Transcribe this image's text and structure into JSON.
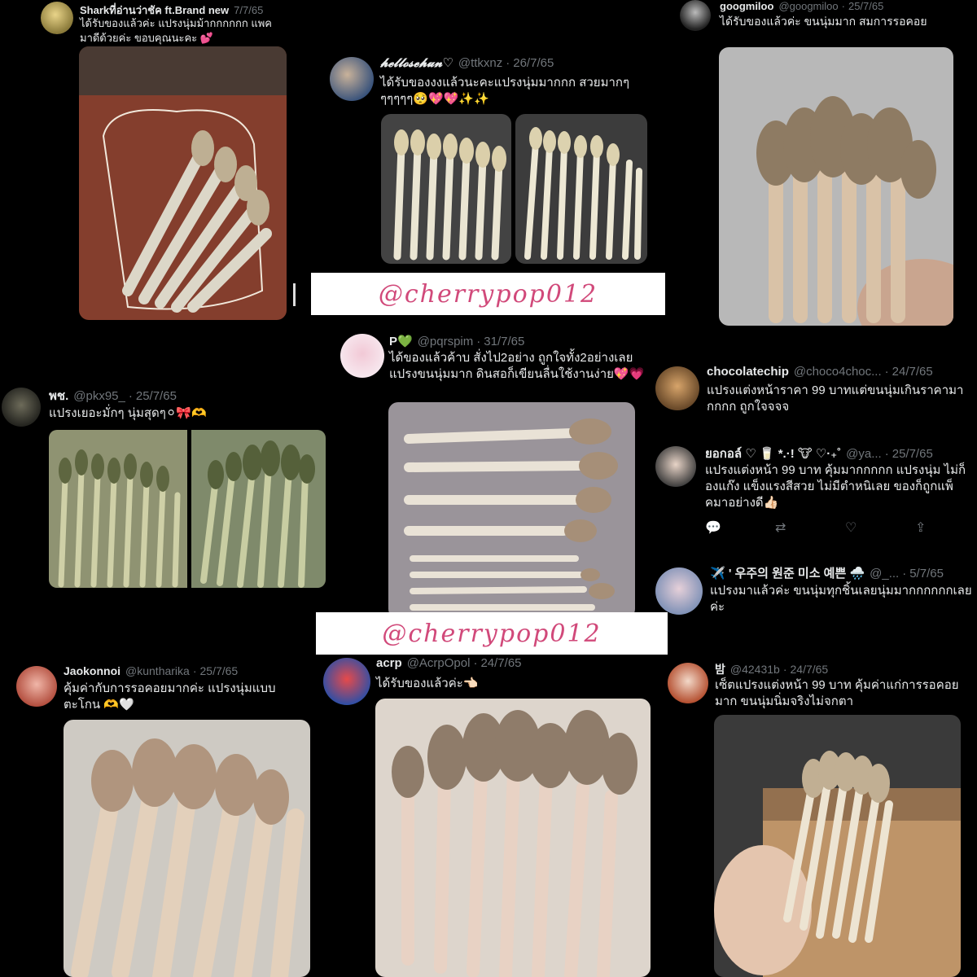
{
  "tweets": [
    {
      "name": "Sharkที่อ่านว่าชัค ft.Brand new",
      "handle": "",
      "date": "7/7/65",
      "text": "ได้รับของแล้วค่ะ แปรงนุ่มม้ากกกกกก แพคมาดีด้วยค่ะ ขอบคุณนะคะ 💕"
    },
    {
      "name": "𝓱𝓮𝓵𝓵𝓸𝓼𝓮𝓱𝓾𝓷♡",
      "handle": "@ttkxnz",
      "date": "26/7/65",
      "text": "ได้รับของงงแล้วนะคะแปรงนุ่มมากกก สวยมากๆๆๆๆๆๆ🥺💖💖✨✨"
    },
    {
      "name": "googmiloo",
      "handle": "@googmiloo",
      "date": "25/7/65",
      "text": "ได้รับของแล้วค่ะ ขนนุ่มมาก สมการรอคอย"
    },
    {
      "name": "P💚",
      "handle": "@pqrspim",
      "date": "31/7/65",
      "text": "ได้ของแล้วค้าบ สั่งไป2อย่าง ถูกใจทั้ง2อย่างเลย แปรงขนนุ่มมาก ดินสอก็เขียนลื่นใช้งานง่าย💖💗"
    },
    {
      "name": "พช.",
      "handle": "@pkx95_",
      "date": "25/7/65",
      "text": "แปรงเยอะมั่กๆ นุ่มสุดๆ⚪🎀🫶"
    },
    {
      "name": "chocolatechip",
      "handle": "@choco4choc...",
      "date": "24/7/65",
      "text": "แปรงแต่งหน้าราคา 99 บาทแต่ขนนุ่มเกินราคามากกกก ถูกใจจจจ"
    },
    {
      "name": "ยอกอล์ ♡ 🥛 *.·! 🐮 ♡·₊˚",
      "handle": "@ya...",
      "date": "25/7/65",
      "text": "แปรงแต่งหน้า 99 บาท คุ้มมากกกกก แปรงนุ่ม ไม่ก็องแก๊ง แข็งแรงสีสวย ไม่มีตำหนิเลย ของก็ถูกแพ็คมาอย่างดี👍🏻"
    },
    {
      "name": "✈️ ' 우주의 원준 미소 예쁜 🌧️",
      "handle": "@_...",
      "date": "5/7/65",
      "text": "แปรงมาแล้วค่ะ ขนนุ่มทุกชิ้นเลยนุ่มมากกกกกกเลยค่ะ"
    },
    {
      "name": "Jaokonnoi",
      "handle": "@kuntharika",
      "date": "25/7/65",
      "text": "คุ้มค่ากับการรอคอยมากค่ะ แปรงนุ่มแบบตะโกน 🫶🤍"
    },
    {
      "name": "acrp",
      "handle": "@AcrpOpol",
      "date": "24/7/65",
      "text": "ได้รับของแล้วค่ะ👈🏻"
    },
    {
      "name": "밤",
      "handle": "@42431b",
      "date": "24/7/65",
      "text": "เซ็ตแปรงแต่งหน้า 99 บาท คุ้มค่าแก่การรอคอยมาก ขนนุ่มนิ่มจริงไม่จกตา"
    }
  ],
  "watermark": "@cherrypop012",
  "colors": {
    "bg": "#000000",
    "text": "#e7e9ea",
    "muted": "#71767b",
    "watermark": "#d1497a"
  }
}
